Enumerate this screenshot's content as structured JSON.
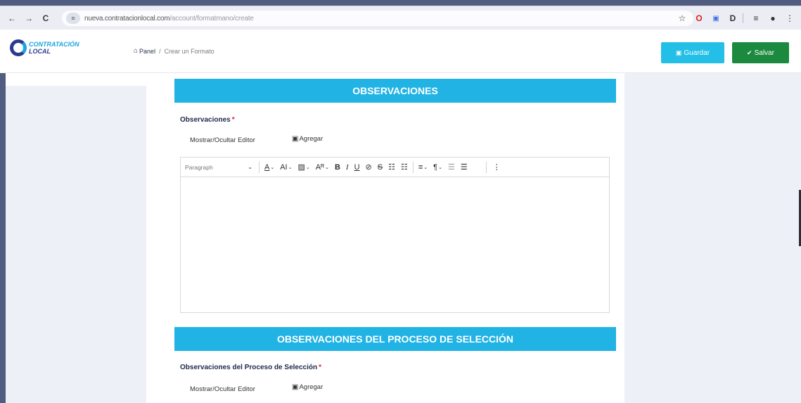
{
  "browser": {
    "back": "←",
    "forward": "→",
    "reload": "C",
    "site_info": "≡",
    "url_host": "nueva.contratacionlocal.com",
    "url_path": "/account/formatmano/create",
    "star": "☆",
    "ext_opera": "O",
    "ext_blue": "▣",
    "ext_puzzle": "D",
    "ext_media": "≡",
    "ext_profile": "●",
    "ext_menu": "⋮"
  },
  "app": {
    "logo_line1": "CONTRATACIÓN",
    "logo_line2": "LOCAL",
    "breadcrumb": {
      "home_icon": "home-icon",
      "panel": "Panel",
      "separator": "/",
      "current": "Crear un Formato"
    },
    "buttons": {
      "guardar": "Guardar",
      "salvar": "Salvar"
    },
    "colors": {
      "accent": "#22b3e5",
      "guardar": "#23bfe6",
      "salvar": "#1b8a3e",
      "required": "#e02424"
    }
  },
  "sections": [
    {
      "heading": "OBSERVACIONES",
      "field_label": "Observaciones",
      "required_mark": "*",
      "toggle_editor": "Mostrar/Ocultar Editor",
      "add_image": "Agregar"
    },
    {
      "heading": "OBSERVACIONES DEL PROCESO DE SELECCIÓN",
      "field_label": "Observaciones del Proceso de Selección",
      "required_mark": "*",
      "toggle_editor": "Mostrar/Ocultar Editor",
      "add_image": "Agregar"
    }
  ],
  "editor": {
    "format_select": "Paragraph",
    "tools": {
      "font_color": "A",
      "font_size": "AI",
      "highlight": "▨",
      "text_style": "Aᴿ",
      "bold": "B",
      "italic": "I",
      "underline": "U",
      "link": "⊘",
      "strikethrough": "S",
      "bullet_list": "☷",
      "numbered_list": "☷",
      "align": "≡",
      "paragraph": "¶",
      "outdent": "☰",
      "indent": "☰",
      "more": "⋮"
    }
  }
}
